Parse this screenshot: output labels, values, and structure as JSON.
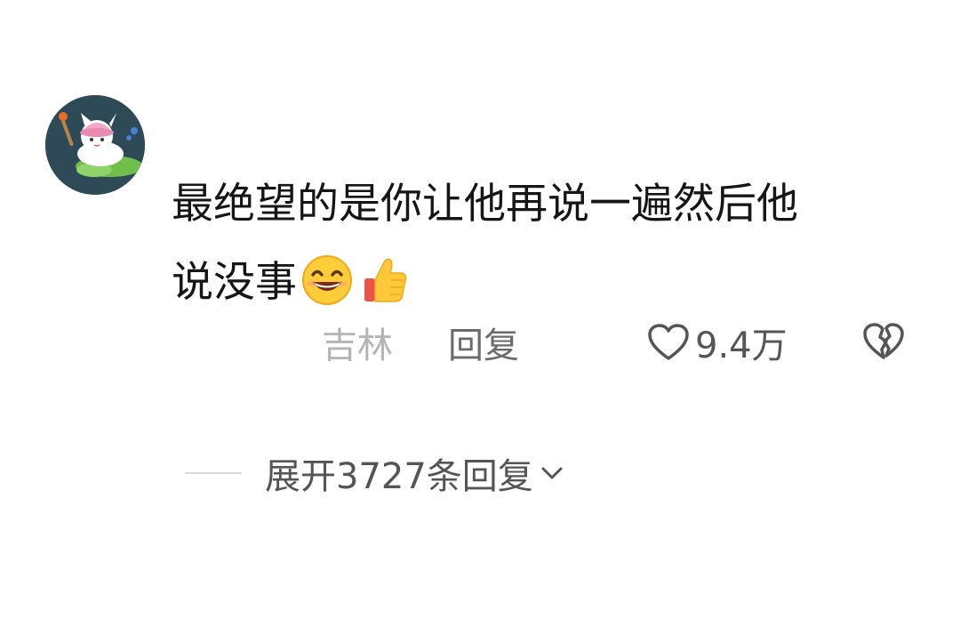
{
  "comment": {
    "text_line1": "最绝望的是你让他再说一遍然后他",
    "text_line2": "说没事",
    "emojis": [
      "grinning-face-emoji",
      "thumbs-up-emoji"
    ]
  },
  "meta": {
    "location": "吉林",
    "reply_label": "回复",
    "like_count": "9.4万"
  },
  "replies": {
    "expand_label": "展开3727条回复"
  },
  "colors": {
    "text": "#161616",
    "muted": "#b4b4b4",
    "secondary": "#555555",
    "avatar_bg": "#2f4a57"
  },
  "icons": {
    "like": "heart-outline-icon",
    "dislike": "broken-heart-icon",
    "expand": "chevron-down-icon"
  }
}
